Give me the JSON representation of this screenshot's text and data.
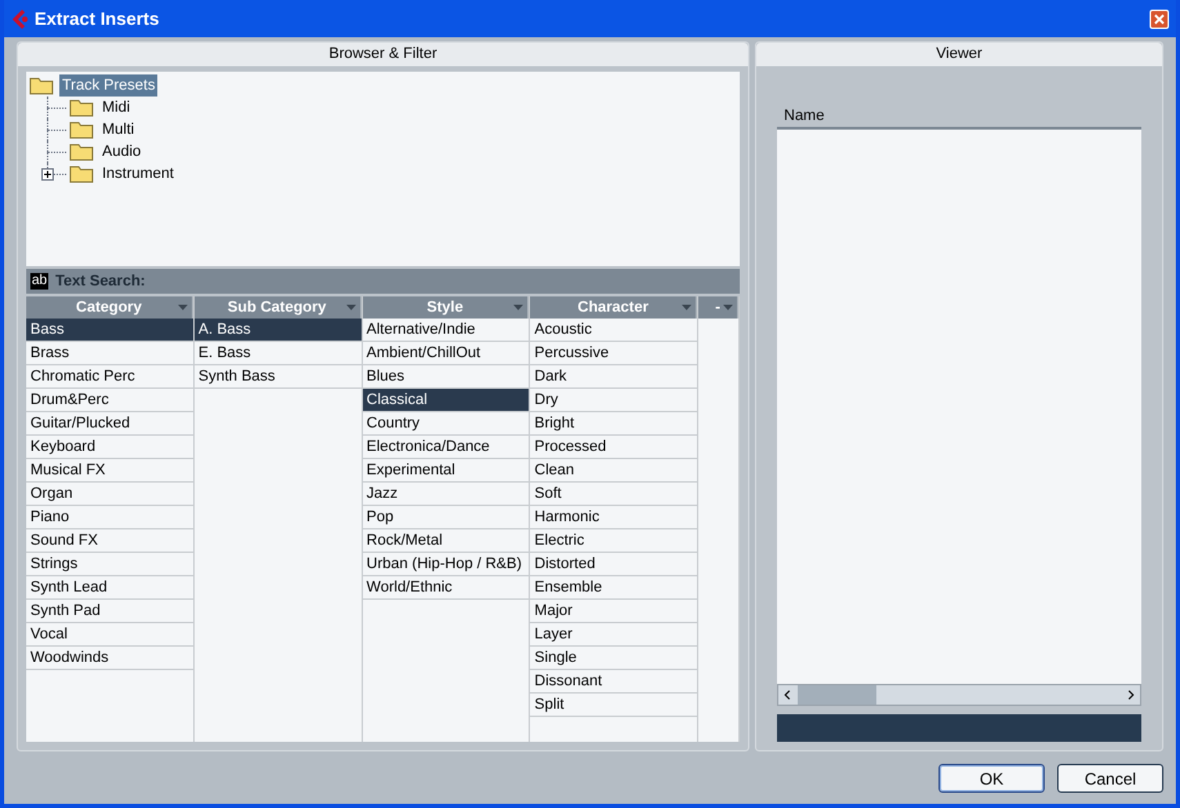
{
  "window": {
    "title": "Extract Inserts"
  },
  "browser": {
    "title": "Browser & Filter",
    "tree": [
      {
        "label": "Track Presets",
        "selected": true,
        "children": [
          {
            "label": "Midi",
            "selected": false
          },
          {
            "label": "Multi",
            "selected": false
          },
          {
            "label": "Audio",
            "selected": false
          },
          {
            "label": "Instrument",
            "selected": false,
            "expanded": false
          }
        ]
      }
    ],
    "text_search": {
      "icon": "ab",
      "label": "Text Search:"
    },
    "columns": [
      {
        "header": "Category",
        "items": [
          {
            "label": "Bass",
            "selected": true
          },
          {
            "label": "Brass",
            "selected": false
          },
          {
            "label": "Chromatic Perc",
            "selected": false
          },
          {
            "label": "Drum&Perc",
            "selected": false
          },
          {
            "label": "Guitar/Plucked",
            "selected": false
          },
          {
            "label": "Keyboard",
            "selected": false
          },
          {
            "label": "Musical FX",
            "selected": false
          },
          {
            "label": "Organ",
            "selected": false
          },
          {
            "label": "Piano",
            "selected": false
          },
          {
            "label": "Sound FX",
            "selected": false
          },
          {
            "label": "Strings",
            "selected": false
          },
          {
            "label": "Synth Lead",
            "selected": false
          },
          {
            "label": "Synth Pad",
            "selected": false
          },
          {
            "label": "Vocal",
            "selected": false
          },
          {
            "label": "Woodwinds",
            "selected": false
          }
        ]
      },
      {
        "header": "Sub Category",
        "items": [
          {
            "label": "A. Bass",
            "selected": true
          },
          {
            "label": "E. Bass",
            "selected": false
          },
          {
            "label": "Synth Bass",
            "selected": false
          }
        ]
      },
      {
        "header": "Style",
        "items": [
          {
            "label": "Alternative/Indie",
            "selected": false
          },
          {
            "label": "Ambient/ChillOut",
            "selected": false
          },
          {
            "label": "Blues",
            "selected": false
          },
          {
            "label": "Classical",
            "selected": true
          },
          {
            "label": "Country",
            "selected": false
          },
          {
            "label": "Electronica/Dance",
            "selected": false
          },
          {
            "label": "Experimental",
            "selected": false
          },
          {
            "label": "Jazz",
            "selected": false
          },
          {
            "label": "Pop",
            "selected": false
          },
          {
            "label": "Rock/Metal",
            "selected": false
          },
          {
            "label": "Urban (Hip-Hop / R&B)",
            "selected": false
          },
          {
            "label": "World/Ethnic",
            "selected": false
          }
        ]
      },
      {
        "header": "Character",
        "items": [
          {
            "label": "Acoustic",
            "selected": false
          },
          {
            "label": "Percussive",
            "selected": false
          },
          {
            "label": "Dark",
            "selected": false
          },
          {
            "label": "Dry",
            "selected": false
          },
          {
            "label": "Bright",
            "selected": false
          },
          {
            "label": "Processed",
            "selected": false
          },
          {
            "label": "Clean",
            "selected": false
          },
          {
            "label": "Soft",
            "selected": false
          },
          {
            "label": "Harmonic",
            "selected": false
          },
          {
            "label": "Electric",
            "selected": false
          },
          {
            "label": "Distorted",
            "selected": false
          },
          {
            "label": "Ensemble",
            "selected": false
          },
          {
            "label": "Major",
            "selected": false
          },
          {
            "label": "Layer",
            "selected": false
          },
          {
            "label": "Single",
            "selected": false
          },
          {
            "label": "Dissonant",
            "selected": false
          },
          {
            "label": "Split",
            "selected": false
          }
        ]
      },
      {
        "header": "-"
      }
    ]
  },
  "viewer": {
    "title": "Viewer",
    "columns": [
      "Name"
    ]
  },
  "buttons": [
    {
      "label": "OK",
      "default": true
    },
    {
      "label": "Cancel",
      "default": false
    }
  ]
}
